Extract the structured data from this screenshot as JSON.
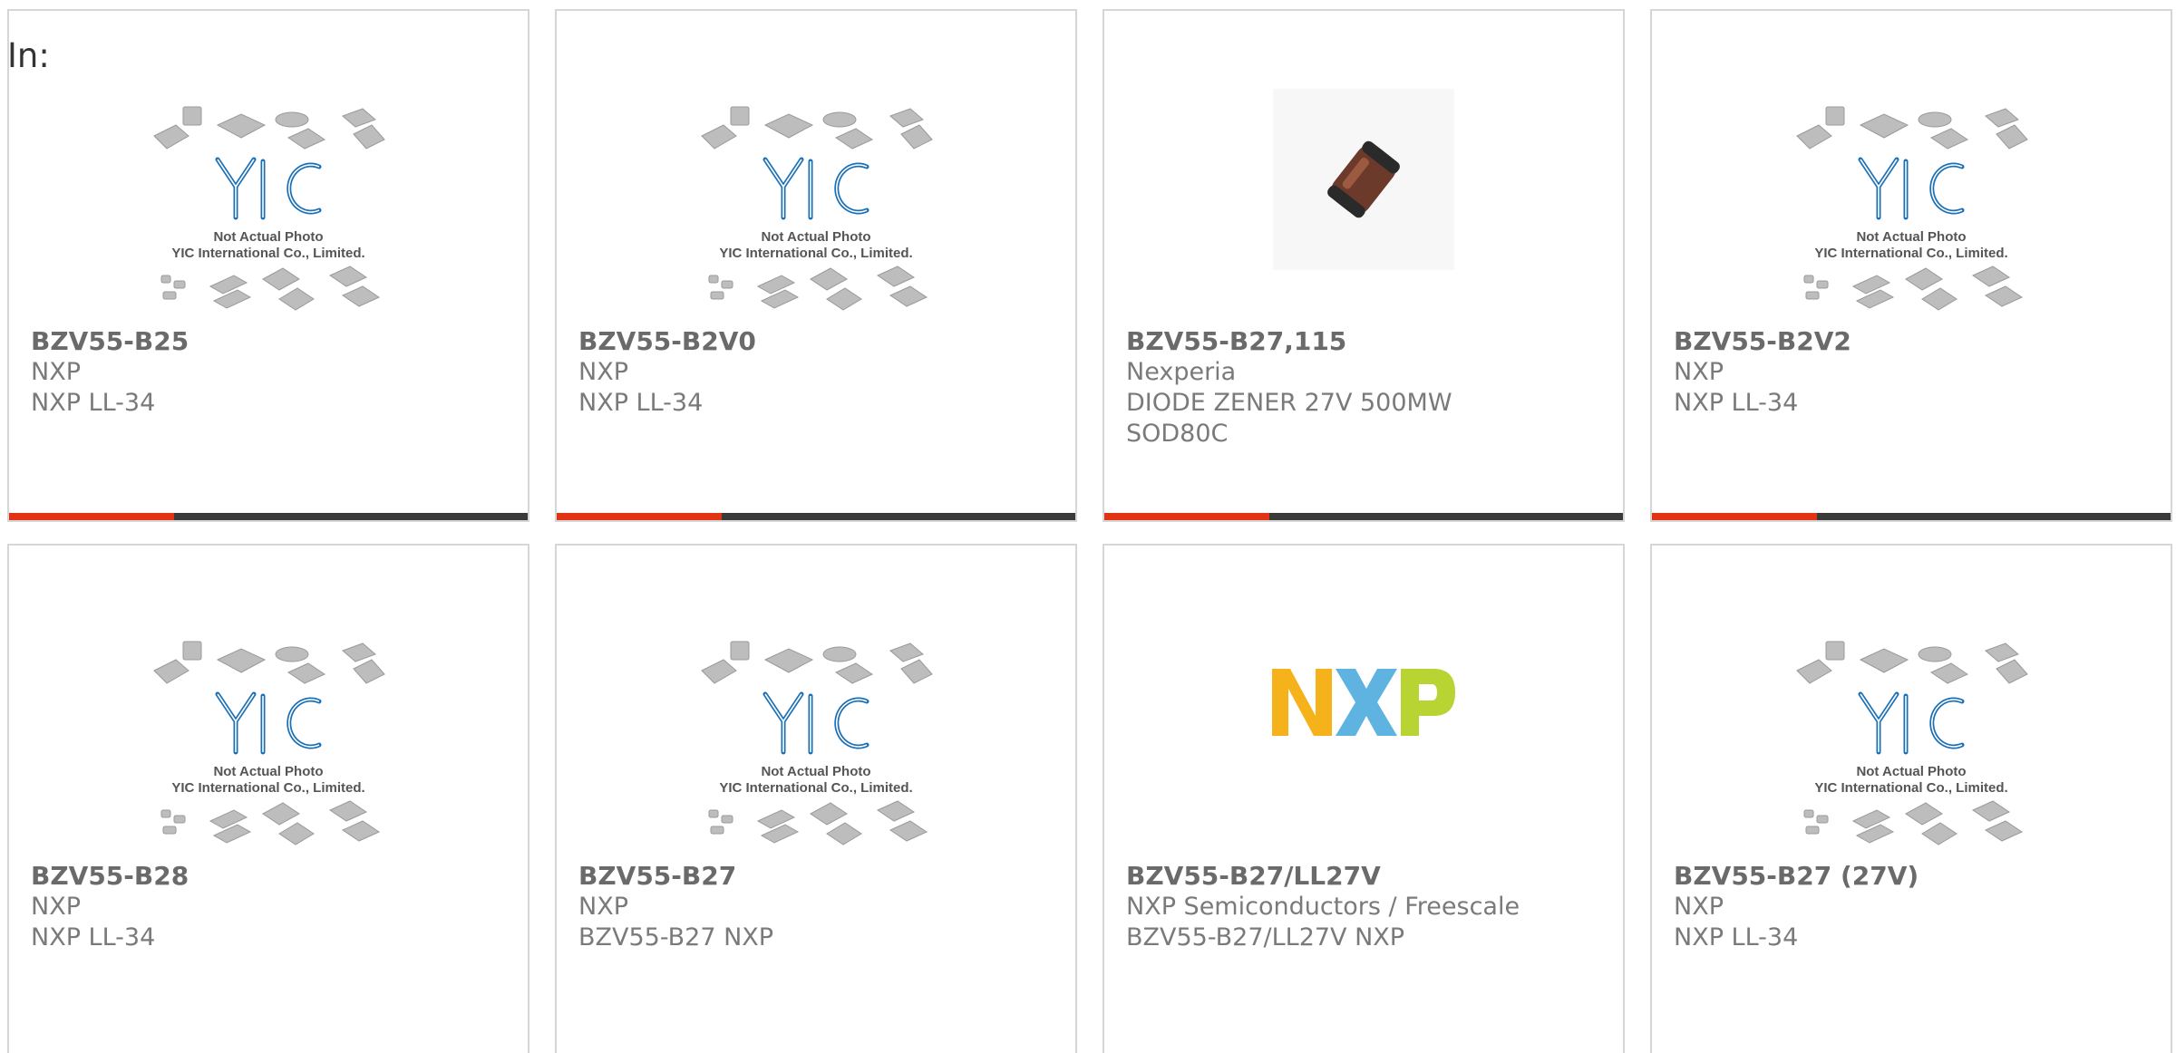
{
  "header": {
    "label": "In:"
  },
  "placeholder_image": {
    "logo_text": "YIC",
    "caption_line1": "Not Actual Photo",
    "caption_line2": "YIC International Co., Limited."
  },
  "colors": {
    "accent": "#e03414",
    "bar_dark": "#3a3a3a",
    "yic_blue": "#1a6fb5",
    "nxp_yellow": "#f5b21b",
    "nxp_blue": "#5fb3e0",
    "nxp_green": "#b8d433"
  },
  "products": [
    {
      "part": "BZV55-B25",
      "manufacturer": "NXP",
      "desc": "NXP LL-34",
      "desc2": "",
      "image": "yic-placeholder"
    },
    {
      "part": "BZV55-B2V0",
      "manufacturer": "NXP",
      "desc": "NXP LL-34",
      "desc2": "",
      "image": "yic-placeholder"
    },
    {
      "part": "BZV55-B27,115",
      "manufacturer": "Nexperia",
      "desc": "DIODE ZENER 27V 500MW",
      "desc2": "SOD80C",
      "image": "diode-photo"
    },
    {
      "part": "BZV55-B2V2",
      "manufacturer": "NXP",
      "desc": "NXP LL-34",
      "desc2": "",
      "image": "yic-placeholder"
    },
    {
      "part": "BZV55-B28",
      "manufacturer": "NXP",
      "desc": "NXP LL-34",
      "desc2": "",
      "image": "yic-placeholder"
    },
    {
      "part": "BZV55-B27",
      "manufacturer": "NXP",
      "desc": "BZV55-B27 NXP",
      "desc2": "",
      "image": "yic-placeholder"
    },
    {
      "part": "BZV55-B27/LL27V",
      "manufacturer": "NXP Semiconductors / Freescale",
      "desc": "BZV55-B27/LL27V NXP",
      "desc2": "",
      "image": "nxp-logo"
    },
    {
      "part": "BZV55-B27 (27V)",
      "manufacturer": "NXP",
      "desc": "NXP LL-34",
      "desc2": "",
      "image": "yic-placeholder"
    }
  ]
}
